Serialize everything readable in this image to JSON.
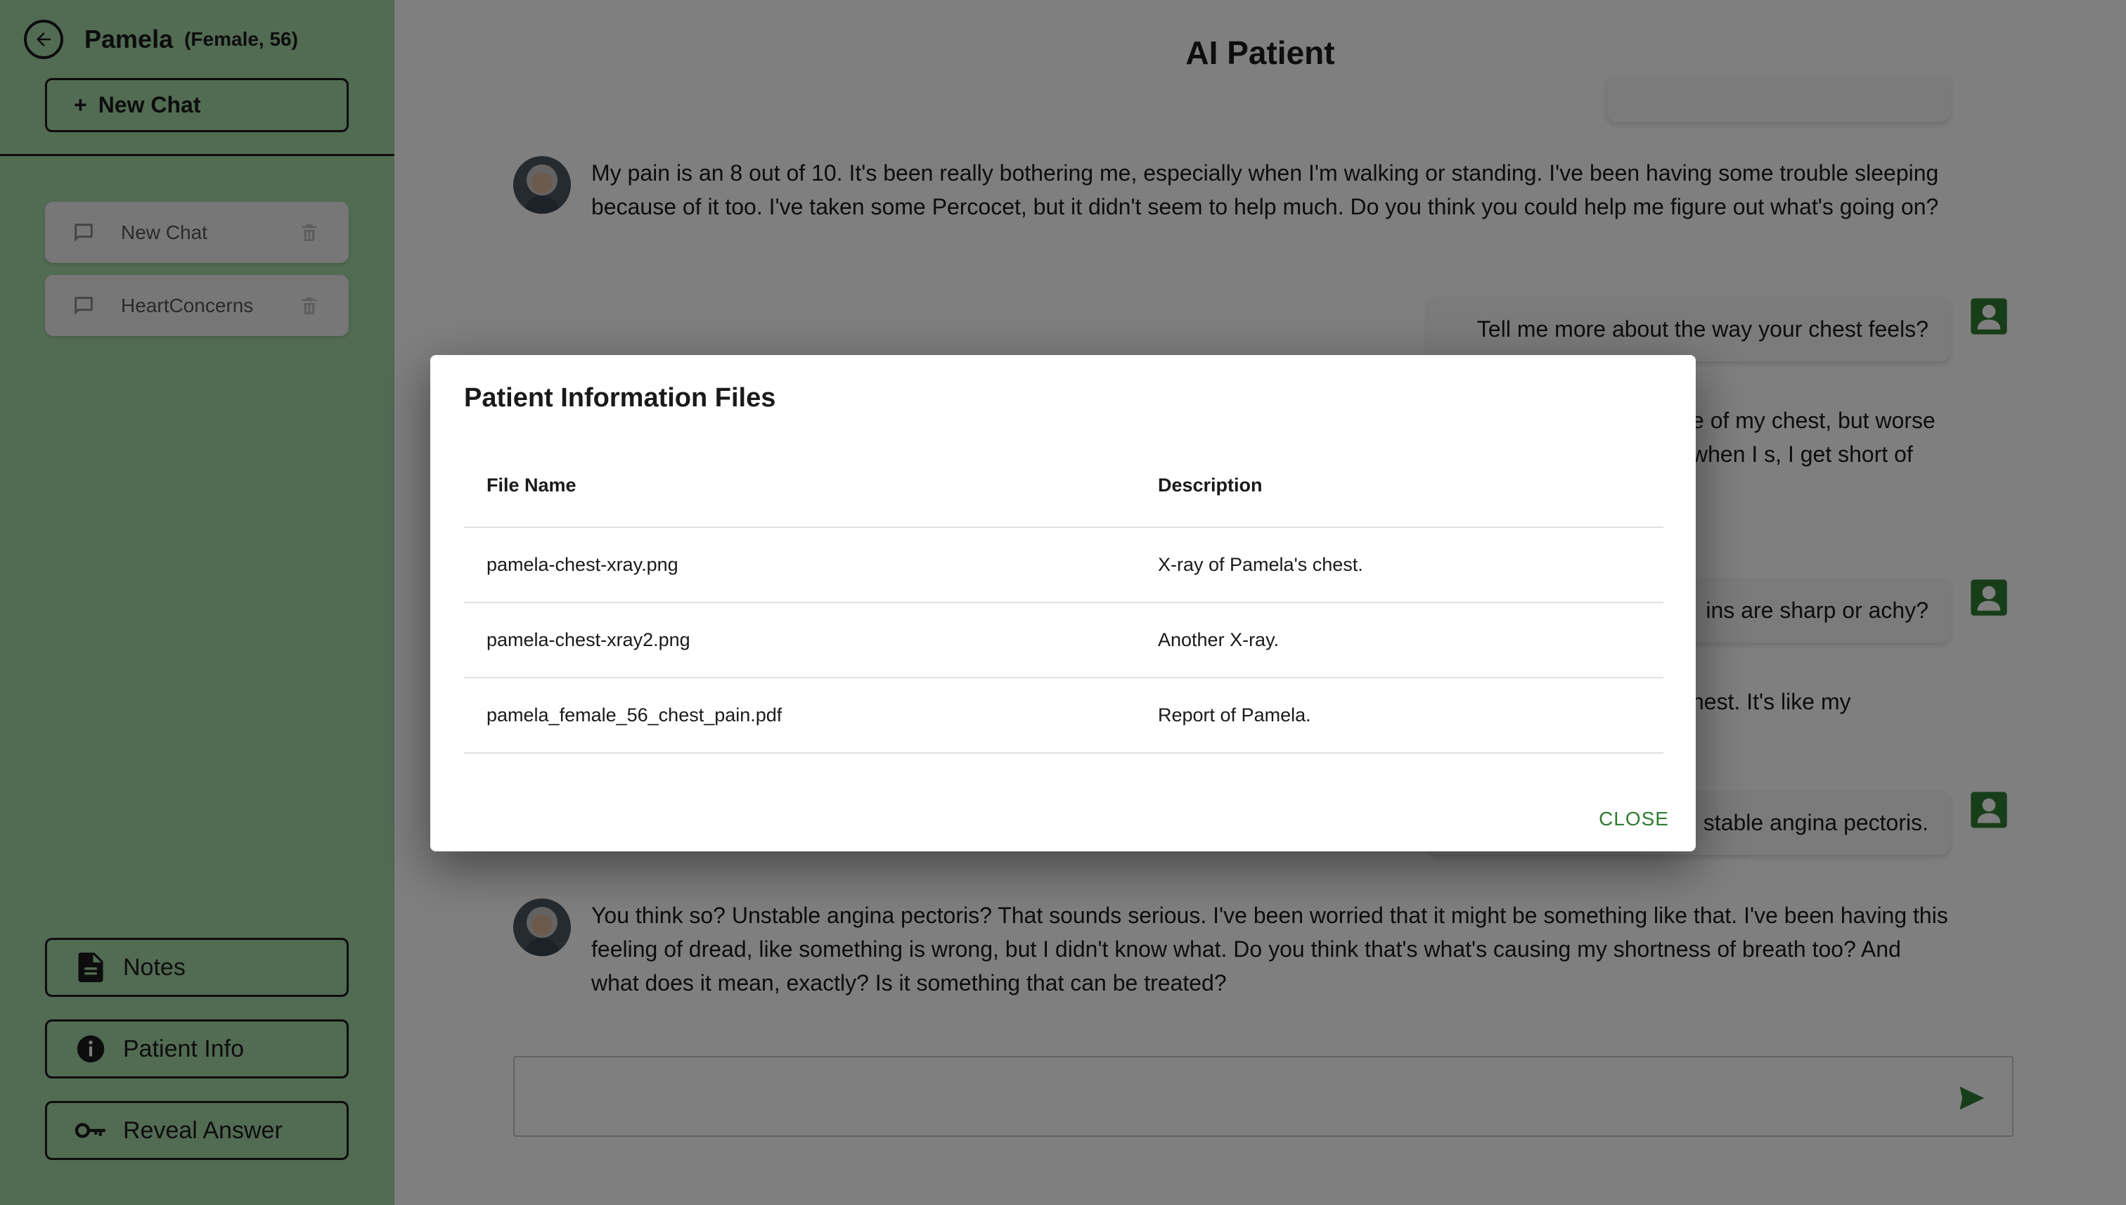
{
  "sidebar": {
    "patient_name": "Pamela",
    "patient_meta": "(Female, 56)",
    "new_chat_label": "New Chat",
    "chats": [
      {
        "label": "New Chat"
      },
      {
        "label": "HeartConcerns"
      }
    ],
    "notes_label": "Notes",
    "patient_info_label": "Patient Info",
    "reveal_answer_label": "Reveal Answer"
  },
  "main": {
    "title": "AI Patient",
    "messages": [
      {
        "role": "ai",
        "text": "My pain is an 8 out of 10. It's been really bothering me, especially when I'm walking or standing. I've been having some trouble sleeping because of it too. I've taken some Percocet, but it didn't seem to help much. Do you think you could help me figure out what's going on?"
      },
      {
        "role": "user",
        "text": "Tell me more about the way your chest feels?"
      },
      {
        "role": "ai",
        "text": "e of my chest, but worse when I s, I get short of"
      },
      {
        "role": "user",
        "text": "ins are sharp or achy?"
      },
      {
        "role": "ai",
        "text": "hest. It's like my"
      },
      {
        "role": "user",
        "text": "stable angina pectoris."
      },
      {
        "role": "ai",
        "text": "You think so? Unstable angina pectoris? That sounds serious. I've been worried that it might be something like that. I've been having this feeling of dread, like something is wrong, but I didn't know what. Do you think that's what's causing my shortness of breath too? And what does it mean, exactly? Is it something that can be treated?"
      }
    ],
    "composer_value": ""
  },
  "modal": {
    "title": "Patient Information Files",
    "columns": [
      "File Name",
      "Description"
    ],
    "rows": [
      {
        "file": "pamela-chest-xray.png",
        "description": "X-ray of Pamela's chest."
      },
      {
        "file": "pamela-chest-xray2.png",
        "description": "Another X-ray."
      },
      {
        "file": "pamela_female_56_chest_pain.pdf",
        "description": "Report of Pamela."
      }
    ],
    "close_label": "CLOSE"
  },
  "colors": {
    "sidebar_bg": "#a5d6a7",
    "accent": "#2e7d32",
    "overlay": "rgba(0,0,0,0.5)"
  },
  "icons": [
    "arrow-left-circle-icon",
    "chat-bubble-icon",
    "trash-icon",
    "document-icon",
    "info-icon",
    "key-icon",
    "user-avatar-icon",
    "send-icon"
  ]
}
